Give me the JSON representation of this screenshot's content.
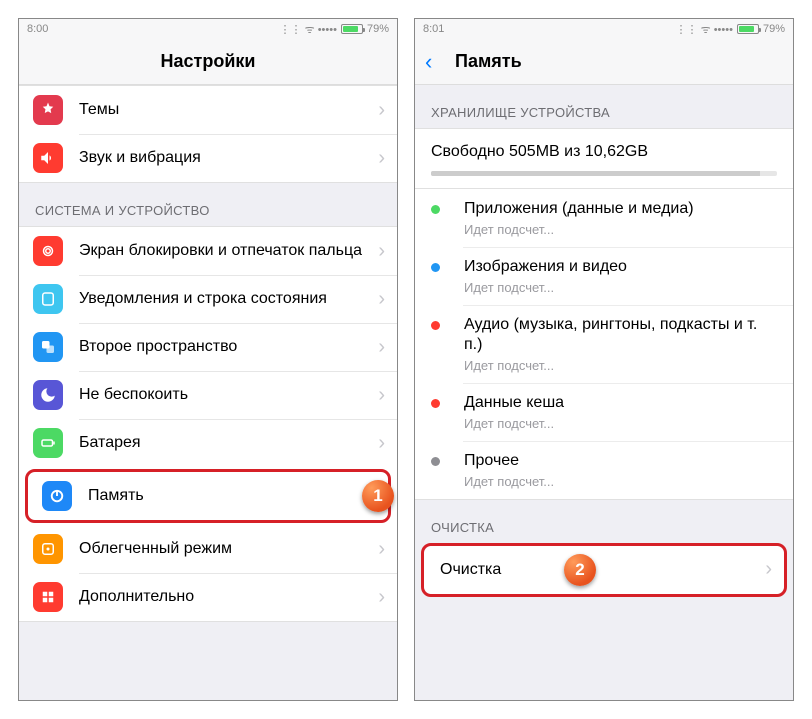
{
  "left": {
    "status": {
      "time": "8:00",
      "battery_pct": "79%"
    },
    "title": "Настройки",
    "group1": [
      {
        "label": "Темы",
        "icon": "themes-icon",
        "color": "#e33a4e"
      },
      {
        "label": "Звук и вибрация",
        "icon": "sound-icon",
        "color": "#ff3b30"
      }
    ],
    "section_system": "СИСТЕМА И УСТРОЙСТВО",
    "group2": [
      {
        "label": "Экран блокировки и отпечаток пальца",
        "icon": "fingerprint-icon",
        "color": "#ff3b30"
      },
      {
        "label": "Уведомления и строка состояния",
        "icon": "notifications-icon",
        "color": "#3ec6f0"
      },
      {
        "label": "Второе пространство",
        "icon": "second-space-icon",
        "color": "#2196f3"
      },
      {
        "label": "Не беспокоить",
        "icon": "dnd-icon",
        "color": "#5856d6"
      },
      {
        "label": "Батарея",
        "icon": "battery-icon",
        "color": "#4cd964"
      },
      {
        "label": "Память",
        "icon": "storage-icon",
        "color": "#1e88f7",
        "highlight": true
      },
      {
        "label": "Облегченный режим",
        "icon": "lite-mode-icon",
        "color": "#ff9500"
      },
      {
        "label": "Дополнительно",
        "icon": "additional-icon",
        "color": "#ff3b30"
      }
    ],
    "badge1": "1"
  },
  "right": {
    "status": {
      "time": "8:01",
      "battery_pct": "79%"
    },
    "title": "Память",
    "section_storage": "ХРАНИЛИЩЕ УСТРОЙСТВА",
    "storage_text": "Свободно 505MB из 10,62GB",
    "usage": [
      {
        "label": "Приложения (данные и медиа)",
        "sub": "Идет подсчет...",
        "color": "#4cd964"
      },
      {
        "label": "Изображения и видео",
        "sub": "Идет подсчет...",
        "color": "#2196f3"
      },
      {
        "label": "Аудио (музыка, рингтоны, подкасты и т. п.)",
        "sub": "Идет подсчет...",
        "color": "#ff3b30"
      },
      {
        "label": "Данные кеша",
        "sub": "Идет подсчет...",
        "color": "#ff3b30"
      },
      {
        "label": "Прочее",
        "sub": "Идет подсчет...",
        "color": "#8e8e93"
      }
    ],
    "section_cleanup": "ОЧИСТКА",
    "cleanup_label": "Очистка",
    "badge2": "2"
  }
}
